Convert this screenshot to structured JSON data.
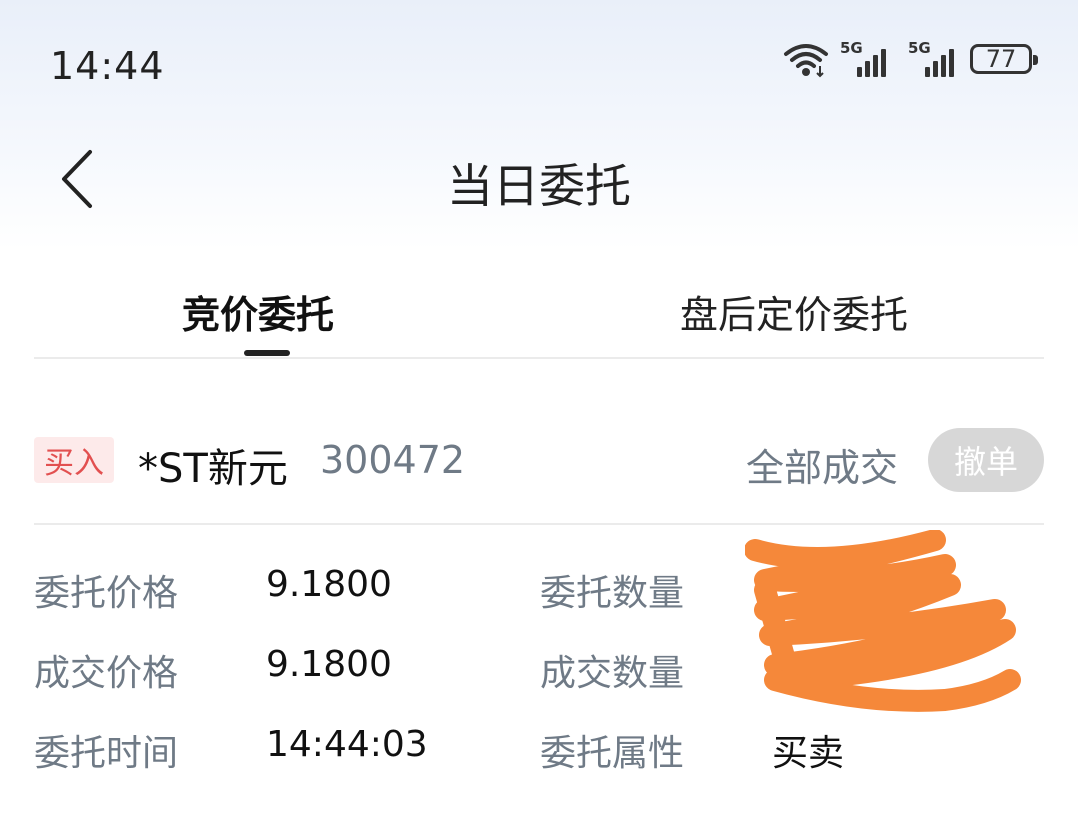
{
  "status_bar": {
    "time": "14:44",
    "network1": "5G",
    "network2": "5G",
    "battery": "77",
    "icons": [
      "wifi-icon",
      "signal-icon",
      "signal-icon",
      "battery-icon"
    ]
  },
  "header": {
    "title": "当日委托",
    "back_icon": "chevron-left-icon"
  },
  "tabs": [
    {
      "label": "竞价委托",
      "active": true
    },
    {
      "label": "盘后定价委托",
      "active": false
    }
  ],
  "order": {
    "side": "买入",
    "stock_name": "*ST新元",
    "stock_code": "300472",
    "status": "全部成交",
    "cancel_label": "撤单",
    "details": {
      "order_price_label": "委托价格",
      "order_price": "9.1800",
      "order_qty_label": "委托数量",
      "deal_price_label": "成交价格",
      "deal_price": "9.1800",
      "deal_qty_label": "成交数量",
      "order_time_label": "委托时间",
      "order_time": "14:44:03",
      "order_attr_label": "委托属性",
      "order_attr": "买卖"
    }
  },
  "colors": {
    "accent_red": "#e25050",
    "badge_bg": "#fdeaea",
    "gray_text": "#6f7a86",
    "cancel_bg": "#d7d7d7",
    "redaction": "#f5883a"
  }
}
